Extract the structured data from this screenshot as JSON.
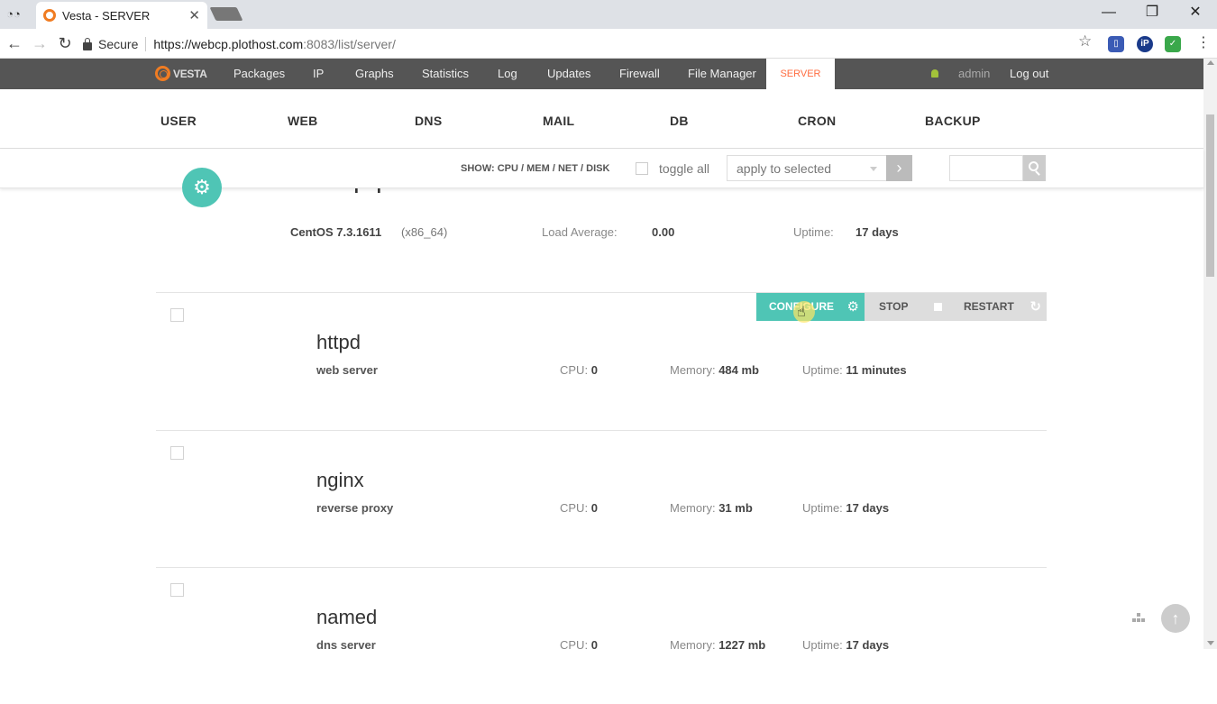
{
  "browser": {
    "tab_title": "Vesta - SERVER",
    "tab_close": "✕",
    "window_controls": [
      "—",
      "❐",
      "✕"
    ],
    "secure_label": "Secure",
    "url_host": "https://webcp.plothost.com",
    "url_rest": ":8083/list/server/",
    "extensions": [
      {
        "name": "bookmark-ext-icon",
        "color": "#3b5bb5",
        "glyph": "▯"
      },
      {
        "name": "ip-ext-icon",
        "color": "#1a3a8a",
        "glyph": "iP"
      },
      {
        "name": "shield-ext-icon",
        "color": "#3aa84b",
        "glyph": "✓"
      }
    ]
  },
  "topnav": {
    "logo": "VESTA",
    "items": [
      "Packages",
      "IP",
      "Graphs",
      "Statistics",
      "Log",
      "Updates",
      "Firewall",
      "File Manager"
    ],
    "active": "SERVER",
    "user": "admin",
    "logout": "Log out"
  },
  "sections": [
    "USER",
    "WEB",
    "DNS",
    "MAIL",
    "DB",
    "CRON",
    "BACKUP"
  ],
  "toolbar": {
    "show_label": "SHOW: CPU / MEM / NET / DISK",
    "toggle_all": "toggle all",
    "select_value": "apply to selected",
    "apply_glyph": "›"
  },
  "server": {
    "hostname": "webcp.plothost.com",
    "os": "CentOS 7.3.1611",
    "arch": "(x86_64)",
    "load_label": "Load Average:",
    "load_value": "0.00",
    "uptime_label": "Uptime:",
    "uptime_value": "17 days"
  },
  "row_actions": {
    "configure": "CONFIGURE",
    "stop": "STOP",
    "restart": "RESTART"
  },
  "services": [
    {
      "name": "httpd",
      "desc": "web server",
      "cpu_label": "CPU:",
      "cpu": "0",
      "mem_label": "Memory:",
      "mem": "484 mb",
      "up_label": "Uptime:",
      "uptime": "11 minutes"
    },
    {
      "name": "nginx",
      "desc": "reverse proxy",
      "cpu_label": "CPU:",
      "cpu": "0",
      "mem_label": "Memory:",
      "mem": "31 mb",
      "up_label": "Uptime:",
      "uptime": "17 days"
    },
    {
      "name": "named",
      "desc": "dns server",
      "cpu_label": "CPU:",
      "cpu": "0",
      "mem_label": "Memory:",
      "mem": "1227 mb",
      "up_label": "Uptime:",
      "uptime": "17 days"
    }
  ],
  "colors": {
    "accent": "#4fc5b5",
    "active_nav_text": "#ff6e42",
    "nav_bg": "#555555",
    "logo_orange": "#f07c22"
  }
}
